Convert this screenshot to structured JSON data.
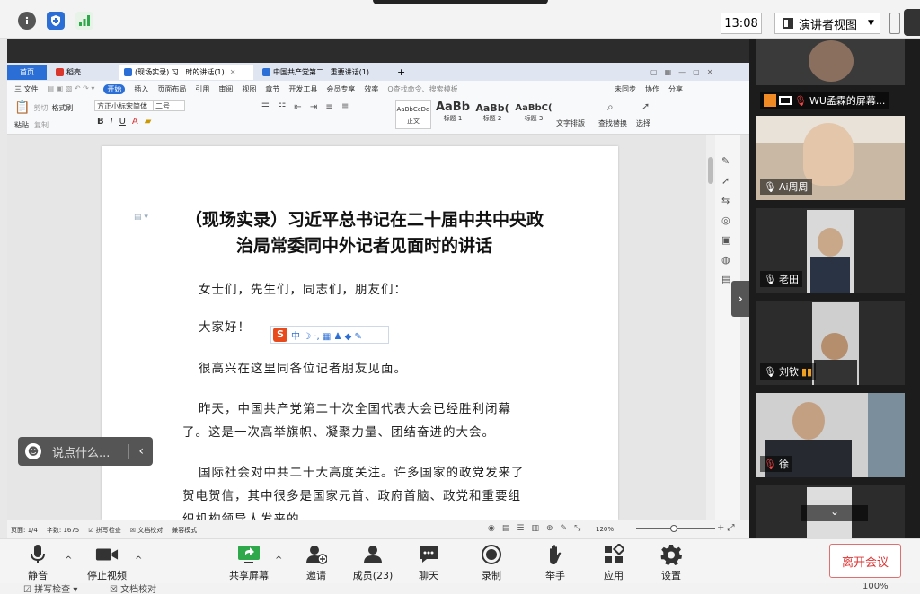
{
  "topbar": {
    "time": "13:08",
    "presenter_view": "演讲者视图"
  },
  "wps": {
    "tabs": [
      {
        "label": "首页"
      },
      {
        "label": "稻壳"
      },
      {
        "label": "(现场实录) 习...时的讲话(1)"
      },
      {
        "label": "中国共产党第二...重要讲话(1)"
      }
    ],
    "menu": [
      "三 文件",
      "开始",
      "插入",
      "页面布局",
      "引用",
      "审阅",
      "视图",
      "章节",
      "开发工具",
      "会员专享",
      "效率",
      "Q查找命令、搜索模板"
    ],
    "right_menu": [
      "未同步",
      "协作",
      "分享"
    ],
    "font_name": "方正小标宋简体",
    "font_size": "二号",
    "ribbon_left": [
      "粘贴",
      "剪切",
      "复制",
      "格式刷"
    ],
    "styles": [
      {
        "preview": "AaBbCcDd",
        "name": "正文"
      },
      {
        "preview": "AaBb",
        "name": "标题 1"
      },
      {
        "preview": "AaBb(",
        "name": "标题 2"
      },
      {
        "preview": "AaBbC(",
        "name": "标题 3"
      }
    ],
    "ribbon_right": [
      "文字排版",
      "查找替换",
      "选择"
    ]
  },
  "document": {
    "title": "（现场实录）习近平总书记在二十届中共中央政治局常委同中外记者见面时的讲话",
    "p1": "女士们，先生们，同志们，朋友们：",
    "p2": "大家好！",
    "p3": "很高兴在这里同各位记者朋友见面。",
    "p4_line1": "昨天，中国共产党第二十次全国代表大会已经胜利闭幕",
    "p4_line2": "了。这是一次高举旗帜、凝聚力量、团结奋进的大会。",
    "p5_line1": "国际社会对中共二十大高度关注。许多国家的政党发来了",
    "p5_line2": "贺电贺信，其中很多是国家元首、政府首脑、政党和重要组",
    "p5_line3": "织机构领导人发来的。"
  },
  "status": {
    "page": "页面: 1/4",
    "words": "字数: 1675",
    "spell": "拼写检查",
    "proof": "文档校对",
    "compat": "兼容模式",
    "zoom": "120%"
  },
  "chat_pill": {
    "placeholder": "说点什么..."
  },
  "participants": [
    {
      "name": "WU孟霖的屏幕..."
    },
    {
      "name": "Ai周周"
    },
    {
      "name": "老田"
    },
    {
      "name": "刘钦"
    },
    {
      "name": "徐"
    }
  ],
  "toolbar": {
    "mute": "静音",
    "stop_video": "停止视频",
    "share_screen": "共享屏幕",
    "invite": "邀请",
    "members": "成员(23)",
    "chat": "聊天",
    "record": "录制",
    "raise_hand": "举手",
    "apps": "应用",
    "settings": "设置",
    "leave": "离开会议"
  },
  "bottom_strip": {
    "spell": "拼写检查",
    "proof": "文档校对",
    "zoom": "100%"
  },
  "colors": {
    "accent_blue": "#2b6fd6",
    "wps_red": "#d9372c",
    "leave_red": "#dd3333",
    "green": "#2ea84a"
  }
}
